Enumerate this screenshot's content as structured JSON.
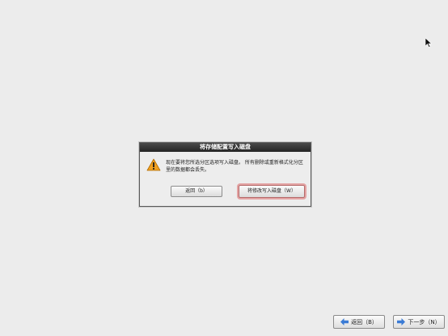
{
  "dialog": {
    "title": "将存储配置写入磁盘",
    "message": "现在要将您所选分区选项写入磁盘。 所有删除或重新格式化分区里的数据都会丢失。",
    "back_button": "返回（b）",
    "write_button": "将修改写入磁盘（W）"
  },
  "nav": {
    "back_label": "返回（B）",
    "next_label": "下一步（N）"
  },
  "colors": {
    "background": "#ececec",
    "titlebar": "#2f2f2f",
    "warning": "#f0a020",
    "nav_arrow": "#3a7bd5",
    "focus_ring": "#e3a3a3"
  },
  "icons": {
    "warning": "warning-icon",
    "back_arrow": "arrow-left-icon",
    "next_arrow": "arrow-right-icon",
    "cursor": "mouse-pointer-icon"
  }
}
